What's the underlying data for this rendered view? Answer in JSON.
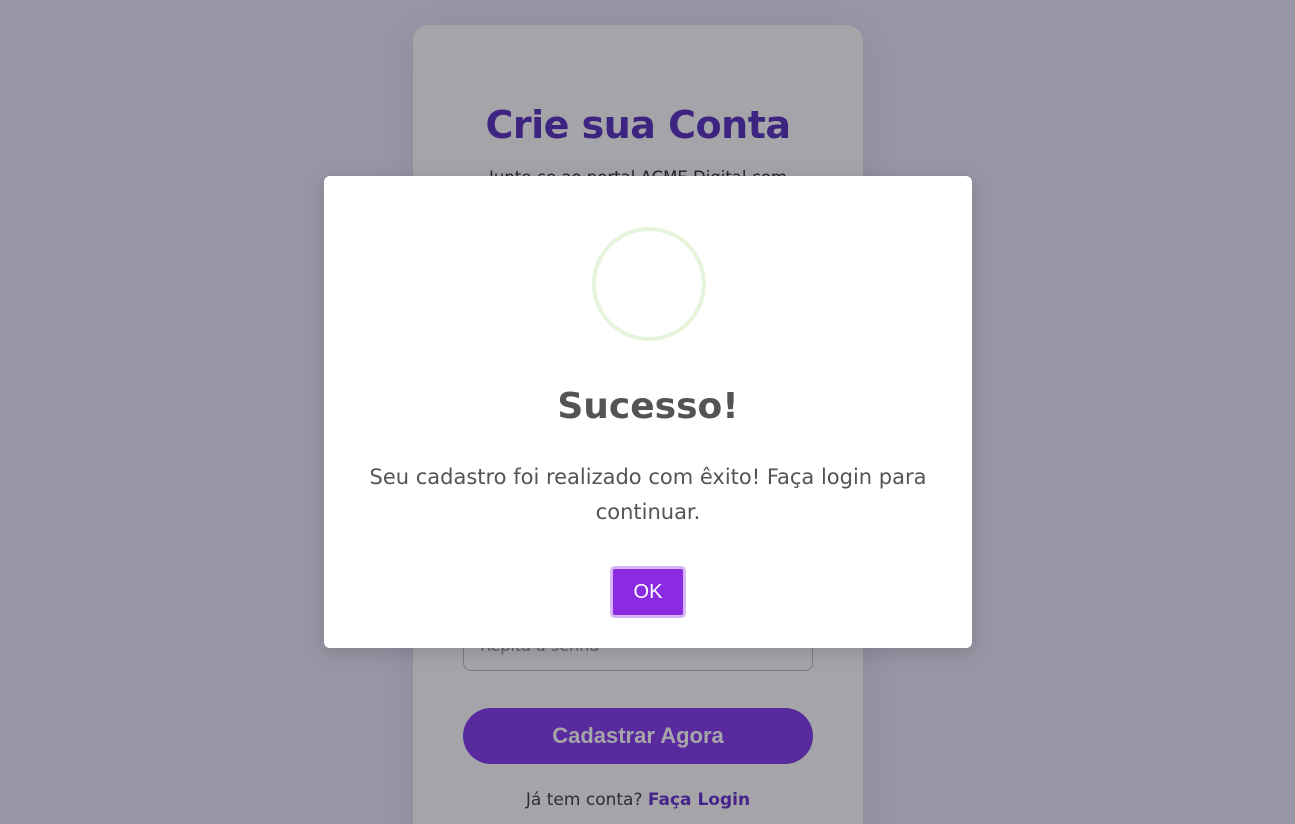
{
  "signup": {
    "title": "Crie sua Conta",
    "subtitle": "Junte-se ao portal ACME Digital com",
    "confirm_password_placeholder": "Repita a senha",
    "submit_label": "Cadastrar Agora",
    "login_prompt": "Já tem conta?",
    "login_link": "Faça Login"
  },
  "modal": {
    "icon": "success-icon",
    "title": "Sucesso!",
    "message": "Seu cadastro foi realizado com êxito! Faça login para continuar.",
    "ok_label": "OK"
  },
  "colors": {
    "accent": "#8a2be2",
    "title": "#4a22b8",
    "success_ring": "#e6f4dc"
  }
}
